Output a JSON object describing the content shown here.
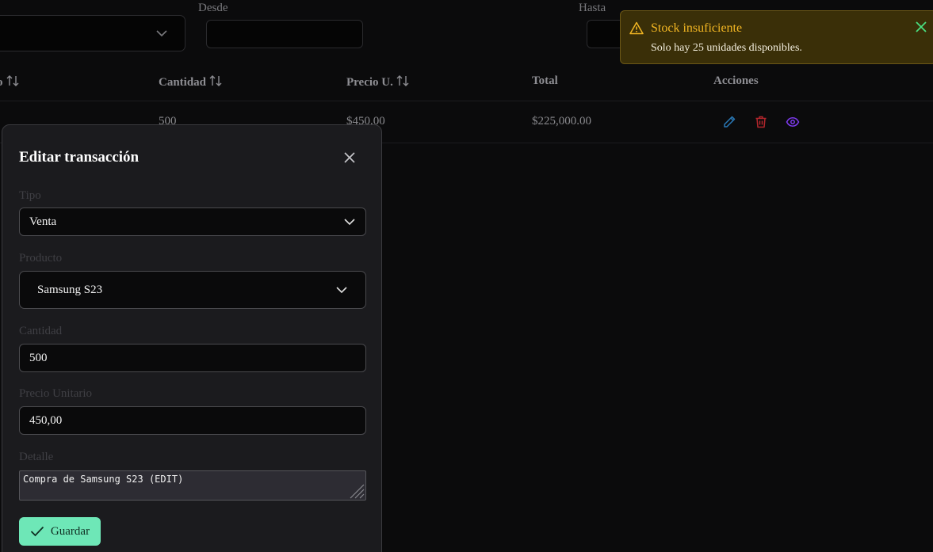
{
  "filters": {
    "desde_label": "Desde",
    "hasta_label": "Hasta"
  },
  "table": {
    "headers": {
      "partial_first_char": "o",
      "cantidad": "Cantidad",
      "precio": "Precio U.",
      "total": "Total",
      "acciones": "Acciones"
    },
    "rows": [
      {
        "cantidad": "500",
        "precio": "$450.00",
        "total": "$225,000.00"
      }
    ]
  },
  "modal": {
    "title": "Editar transacción",
    "tipo_label": "Tipo",
    "tipo_value": "Venta",
    "producto_label": "Producto",
    "producto_value": "Samsung S23",
    "cantidad_label": "Cantidad",
    "cantidad_value": "500",
    "precio_label": "Precio Unitario",
    "precio_value": "450,00",
    "detalle_label": "Detalle",
    "detalle_value": "Compra de Samsung S23 (EDIT)",
    "save_label": "Guardar"
  },
  "toast": {
    "title": "Stock insuficiente",
    "message": "Solo hay 25 unidades disponibles."
  },
  "colors": {
    "accent_green": "#6ee7b7",
    "warning_yellow": "#f2b623",
    "edit_blue": "#2a7ab8",
    "delete_red": "#b3262c",
    "view_purple": "#7c3aed"
  },
  "icons": {
    "sort": "sort-icon",
    "chevron": "chevron-down-icon",
    "close": "close-icon",
    "edit": "pencil-icon",
    "delete": "trash-icon",
    "view": "eye-icon",
    "warning": "warning-icon",
    "check": "check-icon"
  }
}
